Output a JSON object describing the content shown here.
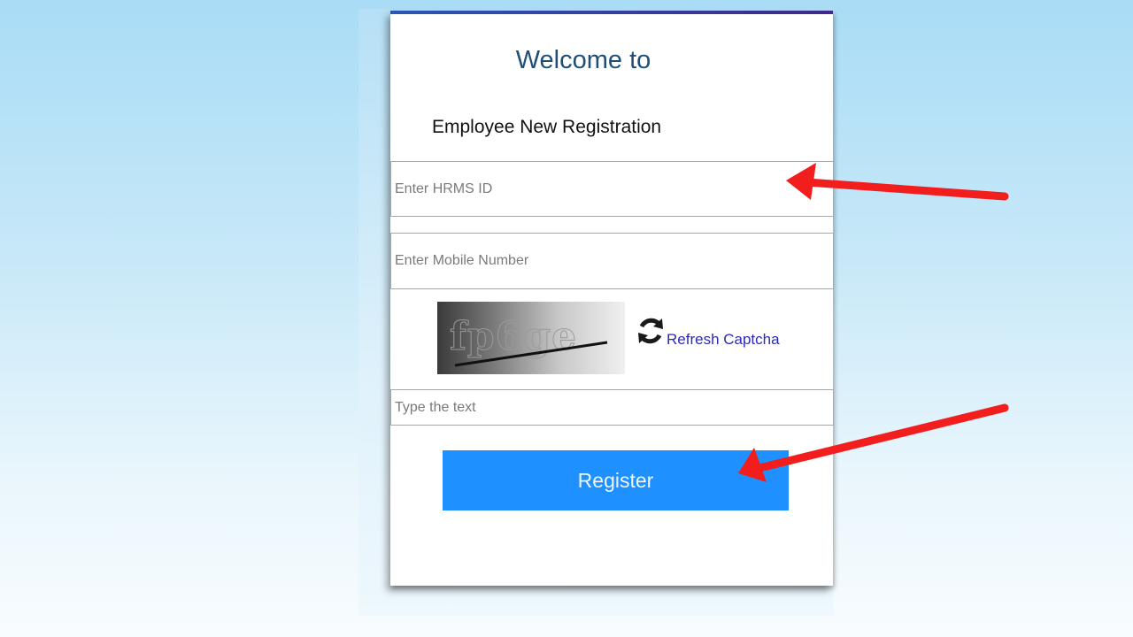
{
  "form": {
    "welcome": "Welcome to",
    "subtitle": "Employee New Registration",
    "hrms_placeholder": "Enter HRMS ID",
    "mobile_placeholder": "Enter Mobile Number",
    "captcha_text": "fp6ge",
    "refresh_label": "Refresh Captcha",
    "captcha_placeholder": "Type the text",
    "register_label": "Register"
  },
  "colors": {
    "accent": "#1e90ff",
    "title": "#1f4e79",
    "link": "#2b2bb3",
    "annotation_arrow": "#f21d1d"
  },
  "icons": {
    "refresh": "refresh-icon",
    "annotation": "red-arrow-icon"
  }
}
